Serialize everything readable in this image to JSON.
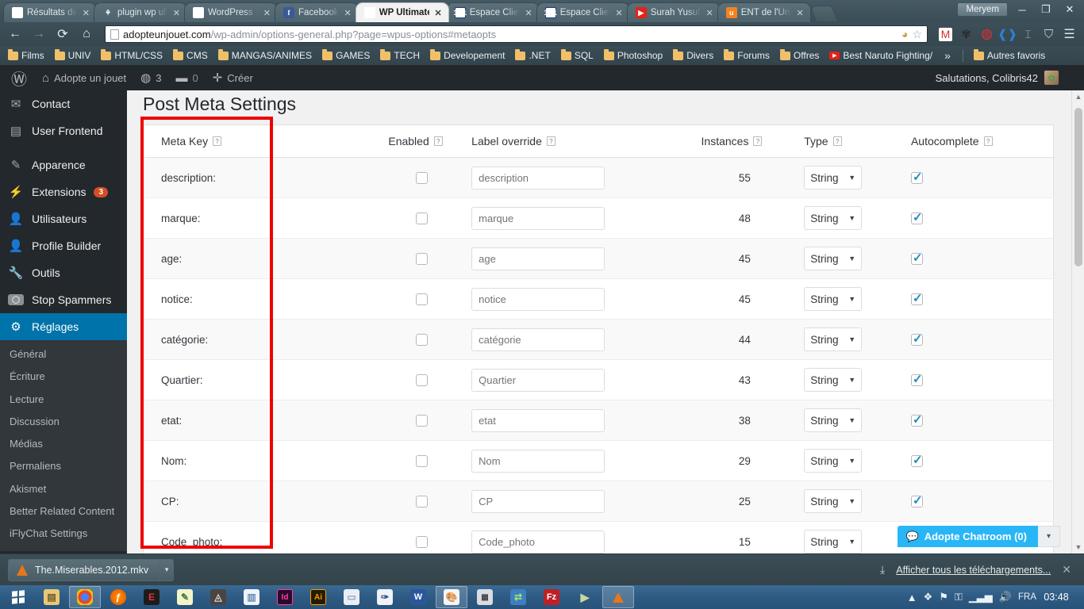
{
  "browser": {
    "tabs": [
      {
        "title": "Résultats de r",
        "favicon": "gmail-icon",
        "active": false
      },
      {
        "title": "plugin wp ult",
        "favicon": "plugin-icon",
        "active": false
      },
      {
        "title": "WordPress › S",
        "favicon": "wordpress-icon",
        "active": false
      },
      {
        "title": "Facebook",
        "favicon": "facebook-icon",
        "active": false
      },
      {
        "title": "WP Ultimate S",
        "favicon": "document-icon",
        "active": true
      },
      {
        "title": "Espace Client",
        "favicon": "1and1-icon",
        "active": false
      },
      {
        "title": "Espace Client",
        "favicon": "1and1-icon",
        "active": false
      },
      {
        "title": "Surah Yusuf -",
        "favicon": "youtube-icon",
        "active": false
      },
      {
        "title": "ENT de l'Univ",
        "favicon": "ent-icon",
        "active": false
      }
    ],
    "window_user": "Meryem",
    "window_controls": [
      "minimize",
      "restore",
      "close"
    ],
    "nav": {
      "back": "←",
      "forward": "⇒",
      "reload": "⟳",
      "home": "⌂"
    },
    "url_domain": "adopteunjouet.com",
    "url_path": "/wp-admin/options-general.php?page=wpus-options#metaopts",
    "extensions": [
      "gmail-icon",
      "gear-icon",
      "opera-icon",
      "blue-icon",
      "cursor-icon",
      "shield-icon",
      "chrome-menu-icon"
    ],
    "bookmarks": [
      {
        "label": "Films",
        "icon": "folder-icon"
      },
      {
        "label": "UNIV",
        "icon": "folder-icon"
      },
      {
        "label": "HTML/CSS",
        "icon": "folder-icon"
      },
      {
        "label": "CMS",
        "icon": "folder-icon"
      },
      {
        "label": "MANGAS/ANIMES",
        "icon": "folder-icon"
      },
      {
        "label": "GAMES",
        "icon": "folder-icon"
      },
      {
        "label": "TECH",
        "icon": "folder-icon"
      },
      {
        "label": "Developement",
        "icon": "folder-icon"
      },
      {
        "label": ".NET",
        "icon": "folder-icon"
      },
      {
        "label": "SQL",
        "icon": "folder-icon"
      },
      {
        "label": "Photoshop",
        "icon": "folder-icon"
      },
      {
        "label": "Divers",
        "icon": "folder-icon"
      },
      {
        "label": "Forums",
        "icon": "folder-icon"
      },
      {
        "label": "Offres",
        "icon": "folder-icon"
      },
      {
        "label": "Best Naruto Fighting/",
        "icon": "youtube-icon"
      }
    ],
    "bookmarks_overflow": "»",
    "other_bookmarks": "Autres favoris"
  },
  "wpadminbar": {
    "logo": "wordpress-icon",
    "site_name": "Adopte un jouet",
    "updates_count": "3",
    "comments_count": "0",
    "new_label": "Créer",
    "greeting": "Salutations, Colibris42"
  },
  "sidebar": {
    "items": [
      {
        "label": "Contact",
        "icon": "mail-icon",
        "gap_after": false
      },
      {
        "label": "User Frontend",
        "icon": "frontend-icon",
        "gap_after": true
      },
      {
        "label": "Apparence",
        "icon": "brush-icon",
        "gap_after": false
      },
      {
        "label": "Extensions",
        "icon": "plug-icon",
        "badge": "3",
        "gap_after": false
      },
      {
        "label": "Utilisateurs",
        "icon": "user-icon",
        "gap_after": false
      },
      {
        "label": "Profile Builder",
        "icon": "profile-icon",
        "gap_after": false
      },
      {
        "label": "Outils",
        "icon": "wrench-icon",
        "gap_after": false
      },
      {
        "label": "Stop Spammers",
        "icon": "stop-icon",
        "gap_after": false
      },
      {
        "label": "Réglages",
        "icon": "settings-icon",
        "current": true,
        "gap_after": false
      }
    ],
    "submenu": [
      "Général",
      "Écriture",
      "Lecture",
      "Discussion",
      "Médias",
      "Permaliens",
      "Akismet",
      "Better Related Content",
      "iFlyChat Settings"
    ]
  },
  "main": {
    "page_title": "Post Meta Settings",
    "columns": [
      {
        "label": "Meta Key",
        "help": "?"
      },
      {
        "label": "Enabled",
        "help": "?"
      },
      {
        "label": "Label override",
        "help": "?"
      },
      {
        "label": "Instances",
        "help": "?"
      },
      {
        "label": "Type",
        "help": "?"
      },
      {
        "label": "Autocomplete",
        "help": "?"
      }
    ],
    "rows": [
      {
        "key": "description:",
        "enabled": false,
        "placeholder": "description",
        "instances": "55",
        "type": "String",
        "autocomplete": true
      },
      {
        "key": "marque:",
        "enabled": false,
        "placeholder": "marque",
        "instances": "48",
        "type": "String",
        "autocomplete": true
      },
      {
        "key": "age:",
        "enabled": false,
        "placeholder": "age",
        "instances": "45",
        "type": "String",
        "autocomplete": true
      },
      {
        "key": "notice:",
        "enabled": false,
        "placeholder": "notice",
        "instances": "45",
        "type": "String",
        "autocomplete": true
      },
      {
        "key": "catégorie:",
        "enabled": false,
        "placeholder": "catégorie",
        "instances": "44",
        "type": "String",
        "autocomplete": true
      },
      {
        "key": "Quartier:",
        "enabled": false,
        "placeholder": "Quartier",
        "instances": "43",
        "type": "String",
        "autocomplete": true
      },
      {
        "key": "etat:",
        "enabled": false,
        "placeholder": "etat",
        "instances": "38",
        "type": "String",
        "autocomplete": true
      },
      {
        "key": "Nom:",
        "enabled": false,
        "placeholder": "Nom",
        "instances": "29",
        "type": "String",
        "autocomplete": true
      },
      {
        "key": "CP:",
        "enabled": false,
        "placeholder": "CP",
        "instances": "25",
        "type": "String",
        "autocomplete": true
      },
      {
        "key": "Code_photo:",
        "enabled": false,
        "placeholder": "Code_photo",
        "instances": "15",
        "type": "String",
        "autocomplete": false
      }
    ],
    "annotation": {
      "color": "#ef0000",
      "shape": "rectangle",
      "target": "Meta Key column"
    }
  },
  "chat_widget": {
    "label": "Adopte Chatroom (0)",
    "icon": "chat-icon",
    "caret": "▾"
  },
  "downloads": {
    "file_name": "The.Miserables.2012.mkv",
    "file_icon": "vlc-icon",
    "caret": "▾",
    "show_all_label": "Afficher tous les téléchargements...",
    "close": "✕"
  },
  "taskbar": {
    "start": "windows-start-icon",
    "items": [
      {
        "icon": "explorer-icon",
        "open": false
      },
      {
        "icon": "chrome-icon",
        "open": true
      },
      {
        "icon": "firefox-icon",
        "open": false
      },
      {
        "icon": "eclipse-icon",
        "open": false
      },
      {
        "icon": "notepadpp-icon",
        "open": false
      },
      {
        "icon": "assassins-creed-icon",
        "open": false
      },
      {
        "icon": "notepad-icon",
        "open": false
      },
      {
        "icon": "indesign-icon",
        "open": false
      },
      {
        "icon": "illustrator-icon",
        "open": false
      },
      {
        "icon": "file-icon",
        "open": false
      },
      {
        "icon": "wordpad-icon",
        "open": false
      },
      {
        "icon": "word-icon",
        "open": false
      },
      {
        "icon": "paint-icon",
        "open": true
      },
      {
        "icon": "calculator-icon",
        "open": false
      },
      {
        "icon": "sharing-icon",
        "open": false
      },
      {
        "icon": "filezilla-icon",
        "open": false
      },
      {
        "icon": "media-player-icon",
        "open": false
      },
      {
        "icon": "vlc-icon",
        "open": true
      }
    ],
    "tray": [
      "show-hidden-icon",
      "action-center-icon",
      "flag-icon",
      "network-error-icon",
      "signal-icon",
      "volume-icon"
    ],
    "language": "FRA",
    "clock": "03:48"
  }
}
